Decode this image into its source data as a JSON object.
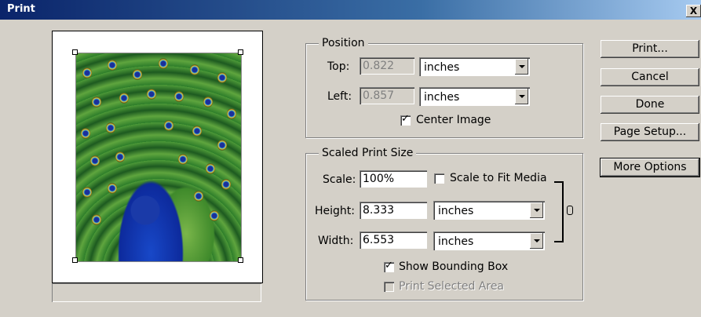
{
  "window": {
    "title": "Print",
    "close_glyph": "X"
  },
  "position": {
    "legend": "Position",
    "top_label": "Top:",
    "top_value": "0.822",
    "top_unit": "inches",
    "left_label": "Left:",
    "left_value": "0.857",
    "left_unit": "inches",
    "center_image_label": "Center Image",
    "center_image_checked": true
  },
  "scaled_print_size": {
    "legend": "Scaled Print Size",
    "scale_label": "Scale:",
    "scale_value": "100%",
    "scale_to_fit_label": "Scale to Fit Media",
    "scale_to_fit_checked": false,
    "height_label": "Height:",
    "height_value": "8.333",
    "height_unit": "inches",
    "width_label": "Width:",
    "width_value": "6.553",
    "width_unit": "inches",
    "show_bounding_box_label": "Show Bounding Box",
    "show_bounding_box_checked": true,
    "print_selected_area_label": "Print Selected Area",
    "print_selected_area_checked": false,
    "link_icon": "chain-link-icon"
  },
  "buttons": {
    "print": "Print...",
    "cancel": "Cancel",
    "done": "Done",
    "page_setup": "Page Setup...",
    "more_options": "More Options"
  },
  "colors": {
    "titlebar_start": "#0a246a",
    "titlebar_end": "#a6caf0",
    "dialog_bg": "#d4d0c8"
  }
}
